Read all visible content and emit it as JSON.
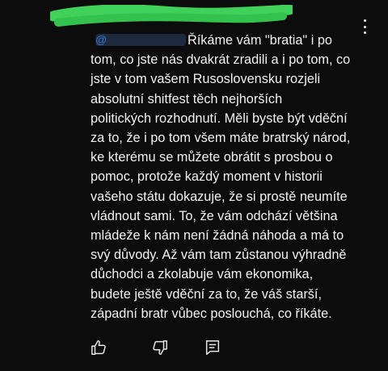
{
  "comment": {
    "mention_handle": "@",
    "lines": [
      "Říkáme vám \"bratia\" i po",
      "tom, co jste nás dvakrát zradili a i po tom, co",
      "jste v tom vašem Rusoslovensku rozjeli",
      "absolutní shitfest těch nejhorších",
      "politických rozhodnutí. Měli byste být vděční",
      "za to, že i po tom všem máte bratrský národ,",
      "ke kterému se můžete obrátit s prosbou o",
      "pomoc, protože každý moment v historii",
      "vašeho státu dokazuje, že si prostě neumíte",
      "vládnout sami. To, že vám odchází většina",
      "mládeže k nám není žádná náhoda a má to",
      "svý důvody. Až vám tam zůstanou výhradně",
      "důchodci a zkolabuje vám ekonomika,",
      "budete ještě vděční za to, že váš starší,",
      "západní bratr vůbec poslouchá, co říkáte."
    ]
  },
  "icons": {
    "more": "more-vert-icon",
    "like": "thumbs-up-icon",
    "dislike": "thumbs-down-icon",
    "reply": "reply-comment-icon"
  },
  "colors": {
    "background": "#0c0c0c",
    "text": "#f2f2f2",
    "mention": "#3e73c7",
    "redaction": "#3fd15a"
  }
}
